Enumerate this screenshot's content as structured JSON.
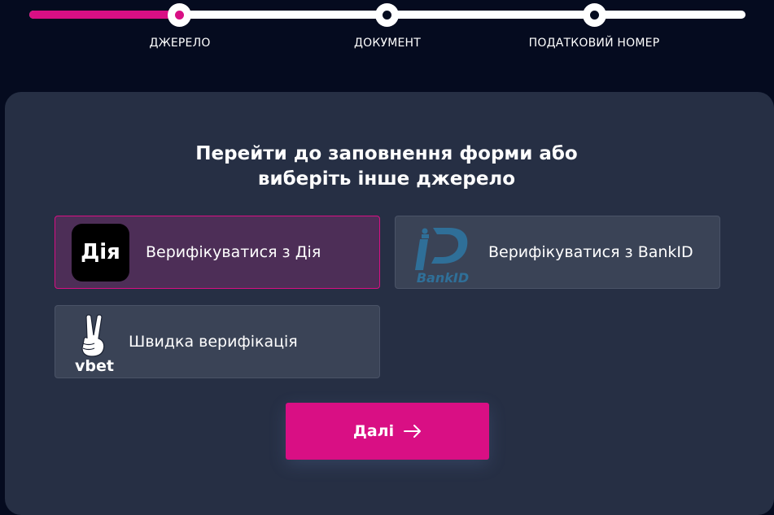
{
  "colors": {
    "background": "#050b1f",
    "card": "#262f44",
    "accent": "#d90f84",
    "option": "#3a4356",
    "option_selected": "#4d2e57"
  },
  "stepper": {
    "progress": 0.21,
    "steps": [
      {
        "label": "ДЖЕРЕЛО",
        "state": "active"
      },
      {
        "label": "ДОКУМЕНТ",
        "state": "pending"
      },
      {
        "label": "ПОДАТКОВИЙ НОМЕР",
        "state": "pending"
      }
    ]
  },
  "heading": {
    "line1": "Перейти до заповнення форми або",
    "line2": "виберіть інше джерело"
  },
  "options": [
    {
      "label": "Верифікуватися з Дія",
      "icon": "diia-logo-icon",
      "logo_text": "Дія",
      "selected": true
    },
    {
      "label": "Верифікуватися з BankID",
      "icon": "bankid-logo-icon",
      "logo_text": "BankID",
      "selected": false
    },
    {
      "label": "Швидка верифікація",
      "icon": "vbet-logo-icon",
      "logo_text": "vbet",
      "selected": false
    }
  ],
  "next_button": {
    "label": "Далі",
    "icon": "arrow-right-icon"
  }
}
